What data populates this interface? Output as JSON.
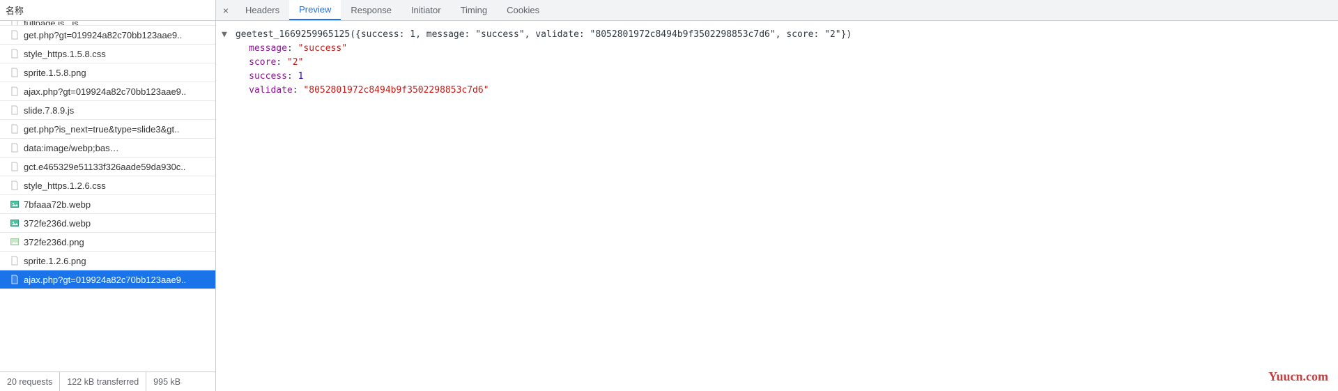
{
  "left": {
    "header": "名称",
    "files": [
      {
        "name": "fullpage.js...js",
        "icon": "file",
        "partial": true
      },
      {
        "name": "get.php?gt=019924a82c70bb123aae9..",
        "icon": "file"
      },
      {
        "name": "style_https.1.5.8.css",
        "icon": "file"
      },
      {
        "name": "sprite.1.5.8.png",
        "icon": "file"
      },
      {
        "name": "ajax.php?gt=019924a82c70bb123aae9..",
        "icon": "file"
      },
      {
        "name": "slide.7.8.9.js",
        "icon": "file"
      },
      {
        "name": "get.php?is_next=true&type=slide3&gt..",
        "icon": "file"
      },
      {
        "name": "data:image/webp;bas…",
        "icon": "data"
      },
      {
        "name": "gct.e465329e51133f326aade59da930c..",
        "icon": "file"
      },
      {
        "name": "style_https.1.2.6.css",
        "icon": "file"
      },
      {
        "name": "7bfaaa72b.webp",
        "icon": "img"
      },
      {
        "name": "372fe236d.webp",
        "icon": "img"
      },
      {
        "name": "372fe236d.png",
        "icon": "img-broken"
      },
      {
        "name": "sprite.1.2.6.png",
        "icon": "file"
      },
      {
        "name": "ajax.php?gt=019924a82c70bb123aae9..",
        "icon": "file",
        "selected": true
      }
    ],
    "status": {
      "requests": "20 requests",
      "transferred": "122 kB transferred",
      "resources": "995 kB"
    }
  },
  "tabs": {
    "close": "×",
    "items": [
      {
        "label": "Headers"
      },
      {
        "label": "Preview",
        "active": true
      },
      {
        "label": "Response"
      },
      {
        "label": "Initiator"
      },
      {
        "label": "Timing"
      },
      {
        "label": "Cookies"
      }
    ]
  },
  "preview": {
    "arrow": "▼",
    "callback_prefix": "geetest_1669259965125(",
    "summary_inner": "{success: 1, message: \"success\", validate: \"8052801972c8494b9f3502298853c7d6\", score: \"2\"}",
    "callback_suffix": ")",
    "props": [
      {
        "key": "message",
        "sep": ": ",
        "val": "\"success\"",
        "cls": "k-str"
      },
      {
        "key": "score",
        "sep": ": ",
        "val": "\"2\"",
        "cls": "k-str"
      },
      {
        "key": "success",
        "sep": ": ",
        "val": "1",
        "cls": "k-num"
      },
      {
        "key": "validate",
        "sep": ": ",
        "val": "\"8052801972c8494b9f3502298853c7d6\"",
        "cls": "k-str"
      }
    ]
  },
  "watermark": "Yuucn.com"
}
